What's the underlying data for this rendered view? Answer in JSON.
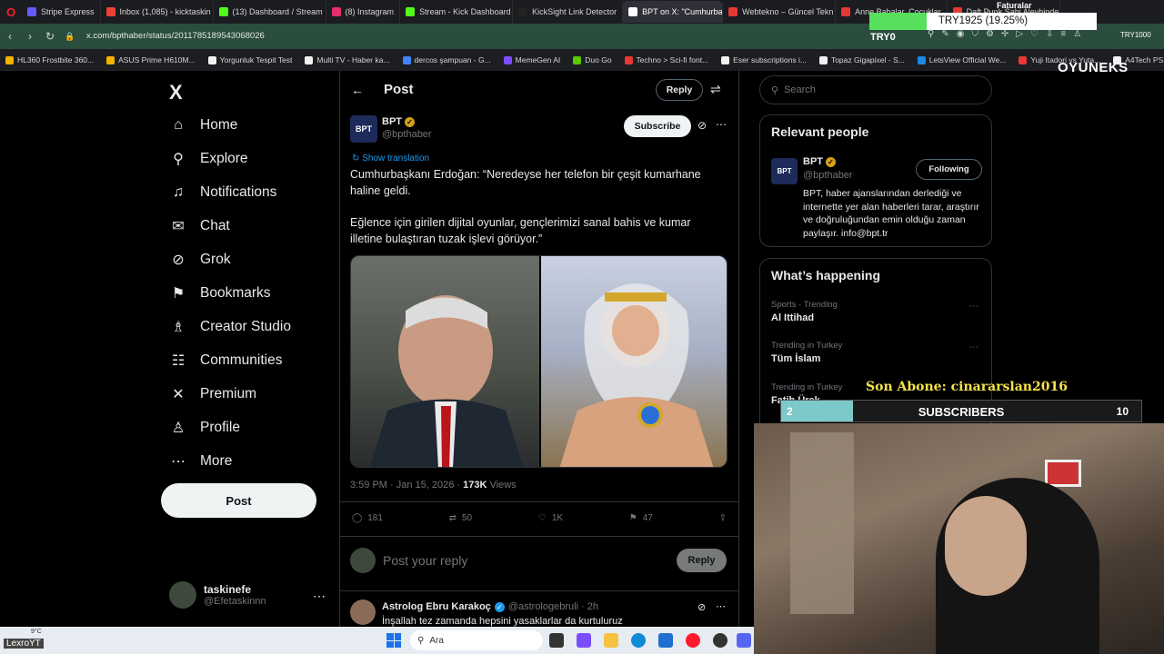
{
  "browser": {
    "tabs": [
      {
        "label": "Stripe Express",
        "color": "#635bff",
        "active": false
      },
      {
        "label": "Inbox (1,085) - kicktaskin",
        "color": "#ea4335",
        "active": false
      },
      {
        "label": "(13) Dashboard / Stream",
        "color": "#53fc18",
        "active": false
      },
      {
        "label": "(8) Instagram",
        "color": "#e1306c",
        "active": false
      },
      {
        "label": "Stream - Kick Dashboard",
        "color": "#53fc18",
        "active": false
      },
      {
        "label": "KickSight Link Detector",
        "color": "#222222",
        "active": false
      },
      {
        "label": "BPT on X: \"Cumhurbaşkan",
        "color": "#ffffff",
        "active": true
      },
      {
        "label": "Webtekno – Güncel Tekn",
        "color": "#e53935",
        "active": false
      },
      {
        "label": "Anne Babalar, Çocuklar",
        "color": "#e53935",
        "active": false
      },
      {
        "label": "Daft Punk Sahi Aleyhinde",
        "color": "#e53935",
        "active": false
      }
    ],
    "url": "x.com/bpthaber/status/2011785189543068026",
    "addr_right_label": "TRY1000",
    "bookmarks": [
      {
        "label": "HL360 Frostbite 360...",
        "color": "#f5b400"
      },
      {
        "label": "ASUS Prime H610M...",
        "color": "#f5b400"
      },
      {
        "label": "Yorgunluk Tespit Test",
        "color": "#f1f1f1"
      },
      {
        "label": "Multi TV - Haber ka...",
        "color": "#f1f1f1"
      },
      {
        "label": "dercos şampuan - G...",
        "color": "#4285f4"
      },
      {
        "label": "MemeGen AI",
        "color": "#7c4dff"
      },
      {
        "label": "Duo Go",
        "color": "#58cc02"
      },
      {
        "label": "Techno > Sci-fi font...",
        "color": "#e53935"
      },
      {
        "label": "Eser subscriptions i...",
        "color": "#f1f1f1"
      },
      {
        "label": "Topaz Gigapixel - S...",
        "color": "#f1f1f1"
      },
      {
        "label": "LetsView Official We...",
        "color": "#1e88e5"
      },
      {
        "label": "Yuji Itadori vs Yuta...",
        "color": "#e53935"
      },
      {
        "label": "A4Tech PS Fsyle...",
        "color": "#f1f1f1"
      }
    ]
  },
  "nav": {
    "logo": "X",
    "items": [
      {
        "label": "Home",
        "icon": "home-icon",
        "glyph": "⌂"
      },
      {
        "label": "Explore",
        "icon": "search-icon",
        "glyph": "⚲"
      },
      {
        "label": "Notifications",
        "icon": "bell-icon",
        "glyph": "♫"
      },
      {
        "label": "Chat",
        "icon": "mail-icon",
        "glyph": "✉"
      },
      {
        "label": "Grok",
        "icon": "grok-icon",
        "glyph": "⊘"
      },
      {
        "label": "Bookmarks",
        "icon": "bookmark-icon",
        "glyph": "⚑"
      },
      {
        "label": "Creator Studio",
        "icon": "creator-studio-icon",
        "glyph": "♗"
      },
      {
        "label": "Communities",
        "icon": "communities-icon",
        "glyph": "☷"
      },
      {
        "label": "Premium",
        "icon": "x-premium-icon",
        "glyph": "✕"
      },
      {
        "label": "Profile",
        "icon": "person-icon",
        "glyph": "♙"
      },
      {
        "label": "More",
        "icon": "more-circle-icon",
        "glyph": "⋯"
      }
    ],
    "post_label": "Post",
    "user_name": "taskinefe",
    "user_handle": "@Efetaskinnn"
  },
  "post": {
    "header_title": "Post",
    "reply_top_label": "Reply",
    "author_name": "BPT",
    "author_handle": "@bpthaber",
    "avatar_text": "BPT",
    "subscribe_label": "Subscribe",
    "show_translation": "Show translation",
    "text_line1": "Cumhurbaşkanı Erdoğan: “Neredeyse her telefon bir çeşit kumarhane haline geldi.",
    "text_line2": "Eğlence için girilen dijital oyunlar, gençlerimizi sanal bahis ve kumar illetine bulaştıran tuzak işlevi görüyor.”",
    "time_date": "3:59 PM · Jan 15, 2026 · ",
    "views_count": "173K",
    "views_label": " Views",
    "replies": "181",
    "reposts": "50",
    "likes": "1K",
    "bookmarks": "47",
    "reply_placeholder": "Post your reply",
    "reply_button": "Reply",
    "comment_author": "Astrolog Ebru Karakoç",
    "comment_handle": "@astrologebruli · 2h",
    "comment_text": "İnşallah tez zamanda hepsini yasaklarlar da kurtuluruz"
  },
  "sidebar": {
    "search_placeholder": "Search",
    "relevant_title": "Relevant people",
    "rp_name": "BPT",
    "rp_handle": "@bpthaber",
    "following_label": "Following",
    "rp_bio": "BPT, haber ajanslarından derlediği ve internette yer alan haberleri tarar, araştırır ve doğruluğundan emin olduğu zaman paylaşır. info@bpt.tr",
    "happening_title": "What’s happening",
    "trends": [
      {
        "context": "Sports · Trending",
        "title": "Al Ittihad"
      },
      {
        "context": "Trending in Turkey",
        "title": "Tüm İslam"
      },
      {
        "context": "Trending in Turkey",
        "title": "Fatih Ürek"
      }
    ]
  },
  "overlays": {
    "faturalar": "Faturalar",
    "goal_label": "TRY1925 (19.25%)",
    "goal_fraction": 0.2525,
    "try0": "TRY0",
    "brand": "OYUNEKS",
    "son_abone": "Son Abone: cinararslan2016",
    "subs_current": "2",
    "subs_label": "SUBSCRIBERS",
    "subs_goal": "10",
    "subs_fraction": 0.2
  },
  "taskbar": {
    "user": "LexroYT",
    "weather": "9°C",
    "search_label": "Ara"
  }
}
